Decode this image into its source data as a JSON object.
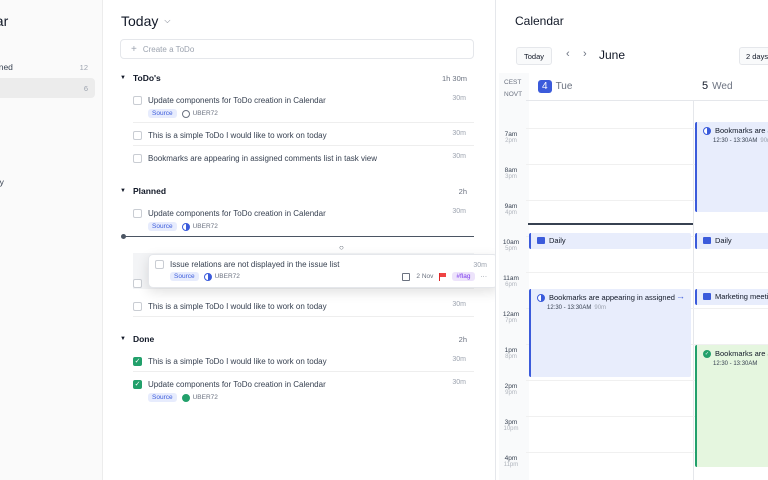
{
  "sidebar": {
    "title": "dar",
    "items": [
      {
        "label": "nned",
        "count": "12"
      },
      {
        "label": "d",
        "count": "6"
      },
      {
        "label": "n",
        "count": ""
      },
      {
        "label": "rry",
        "count": ""
      }
    ]
  },
  "main": {
    "title": "Today",
    "create_placeholder": "Create a ToDo",
    "sections": {
      "todos": {
        "title": "ToDo's",
        "time": "1h 30m"
      },
      "planned": {
        "title": "Planned",
        "time": "2h"
      },
      "done": {
        "title": "Done",
        "time": "2h"
      }
    },
    "todos": [
      {
        "title": "Update components for ToDo creation in Calendar",
        "duration": "30m",
        "source": "Source",
        "issue": "UBER72"
      },
      {
        "title": "This is a simple ToDo I would like to work on today",
        "duration": "30m"
      },
      {
        "title": "Bookmarks are appearing in assigned comments list in task view",
        "duration": "30m"
      }
    ],
    "planned": [
      {
        "title": "Update components for ToDo creation in Calendar",
        "duration": "30m",
        "source": "Source",
        "issue": "UBER72"
      },
      {
        "title": "This is a simple ToDo I would like to work on today",
        "duration": "30m"
      }
    ],
    "dragged": {
      "title": "Issue relations are not displayed in the issue list",
      "duration": "30m",
      "source": "Source",
      "issue": "UBER72",
      "date": "2 Nov",
      "flag": "#flag",
      "more": "···"
    },
    "done": [
      {
        "title": "This is a simple ToDo I would like to work on today",
        "duration": "30m"
      },
      {
        "title": "Update components for ToDo creation in Calendar",
        "duration": "30m",
        "source": "Source",
        "issue": "UBER72"
      }
    ]
  },
  "calendar": {
    "title": "Calendar",
    "today_label": "Today",
    "month": "June",
    "range_label": "2 days",
    "tz": [
      "CEST",
      "NOVT"
    ],
    "days": [
      {
        "num": "4",
        "name": "Tue"
      },
      {
        "num": "5",
        "name": "Wed"
      }
    ],
    "hours": [
      {
        "h": "7am",
        "alt": "2pm"
      },
      {
        "h": "8am",
        "alt": "3pm"
      },
      {
        "h": "9am",
        "alt": "4pm"
      },
      {
        "h": "10am",
        "alt": "5pm"
      },
      {
        "h": "11am",
        "alt": "6pm"
      },
      {
        "h": "12am",
        "alt": "7pm"
      },
      {
        "h": "1pm",
        "alt": "8pm"
      },
      {
        "h": "2pm",
        "alt": "9pm"
      },
      {
        "h": "3pm",
        "alt": "10pm"
      },
      {
        "h": "4pm",
        "alt": "11pm"
      }
    ],
    "events": [
      {
        "title": "Bookmarks are appearing in assigned",
        "time": "12:30 - 13:30AM",
        "sub": "90m"
      },
      {
        "title": "Daily"
      },
      {
        "title": "Bookmarks are appearing in assigned",
        "time": "12:30 - 13:30AM",
        "sub": "90m"
      },
      {
        "title": "Daily"
      },
      {
        "title": "Marketing meetin"
      },
      {
        "title": "Bookmarks are ap",
        "time": "12:30 - 13:30AM"
      }
    ]
  }
}
